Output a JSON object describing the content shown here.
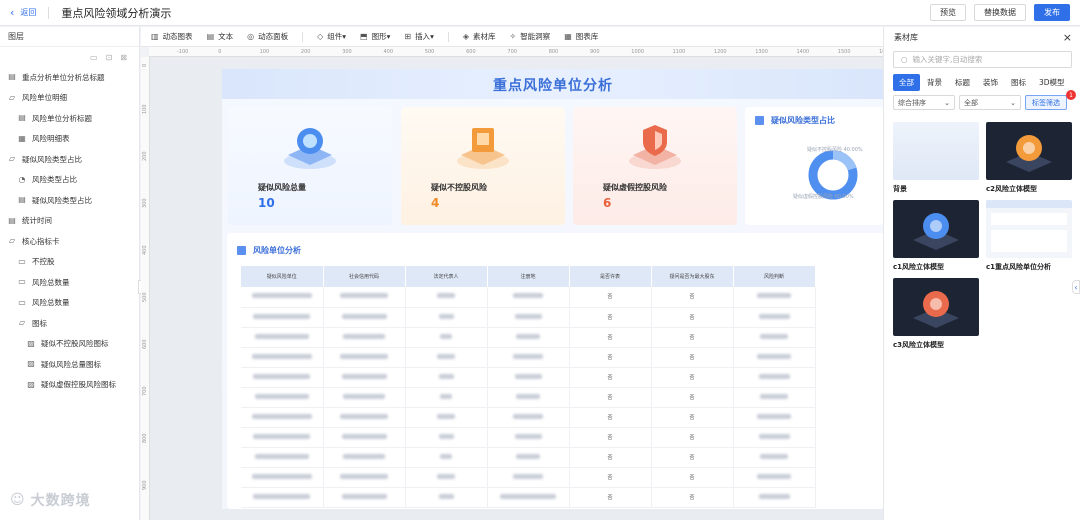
{
  "topbar": {
    "back_label": "返回",
    "title": "重点风险领域分析演示",
    "actions": [
      "预览",
      "替换数据",
      "发布"
    ]
  },
  "layers": {
    "title": "图层",
    "items": [
      {
        "label": "重点分析单位分析总标题",
        "level": 0,
        "icon": "text-icon"
      },
      {
        "label": "风险单位明细",
        "level": 0,
        "icon": "folder-icon"
      },
      {
        "label": "风险单位分析标题",
        "level": 1,
        "icon": "text-icon"
      },
      {
        "label": "风险明细表",
        "level": 1,
        "icon": "table-icon"
      },
      {
        "label": "疑似风险类型占比",
        "level": 0,
        "icon": "folder-icon"
      },
      {
        "label": "风险类型占比",
        "level": 1,
        "icon": "pie-icon"
      },
      {
        "label": "疑似风险类型占比",
        "level": 1,
        "icon": "text-icon"
      },
      {
        "label": "统计时间",
        "level": 0,
        "icon": "text-icon"
      },
      {
        "label": "核心指标卡",
        "level": 0,
        "icon": "folder-icon"
      },
      {
        "label": "不控股",
        "level": 1,
        "icon": "card-icon"
      },
      {
        "label": "风险总数量",
        "level": 1,
        "icon": "card-icon"
      },
      {
        "label": "风险总数量",
        "level": 1,
        "icon": "card-icon"
      },
      {
        "label": "图标",
        "level": 1,
        "icon": "folder-icon"
      },
      {
        "label": "疑似不控股风险图标",
        "level": 2,
        "icon": "image-icon"
      },
      {
        "label": "疑似风险总量图标",
        "level": 2,
        "icon": "image-icon"
      },
      {
        "label": "疑似虚假控股风险图标",
        "level": 2,
        "icon": "image-icon"
      }
    ]
  },
  "toolbar": {
    "items": [
      {
        "label": "动态图表",
        "icon": "chart-icon"
      },
      {
        "label": "文本",
        "icon": "text-icon"
      },
      {
        "label": "动态面板",
        "icon": "panel-icon"
      },
      {
        "label": "组件",
        "icon": "component-icon",
        "dropdown": true
      },
      {
        "label": "图形",
        "icon": "shape-icon",
        "dropdown": true
      },
      {
        "label": "插入",
        "icon": "insert-icon",
        "dropdown": true
      },
      {
        "label": "素材库",
        "icon": "material-icon"
      },
      {
        "label": "智能洞察",
        "icon": "insight-icon"
      },
      {
        "label": "图表库",
        "icon": "library-icon"
      }
    ]
  },
  "ruler": {
    "ticks": [
      "-100",
      "0",
      "100",
      "200",
      "300",
      "400",
      "500",
      "600",
      "700",
      "800",
      "900",
      "1000",
      "1100",
      "1200",
      "1300",
      "1400",
      "1500",
      "1600"
    ],
    "v_ticks": [
      "0",
      "100",
      "200",
      "300",
      "400",
      "500",
      "600",
      "700",
      "800",
      "900"
    ]
  },
  "dashboard": {
    "title": "重点风险单位分析",
    "cards": [
      {
        "label": "疑似风险总量",
        "value": "10",
        "color": "#2f6fe8"
      },
      {
        "label": "疑似不控股风险",
        "value": "4",
        "color": "#f08a24"
      },
      {
        "label": "疑似虚假控股风险",
        "value": "6",
        "color": "#e8603c"
      }
    ],
    "pie": {
      "title": "疑似风险类型占比",
      "legend_top": "疑似不控股风险 40.00%",
      "legend_bottom": "疑似虚假控股风险 60.00%"
    },
    "table": {
      "title": "风险单位分析",
      "headers": [
        "疑似风险单位",
        "社会信用代码",
        "法定代表人",
        "注册地",
        "是否许表",
        "疑问是否为最大股东",
        "风险判断"
      ],
      "second_col_values": [
        "否",
        "否",
        "否",
        "否",
        "否",
        "否",
        "否",
        "否",
        "否",
        "否",
        "否"
      ],
      "third_col_values": [
        "否",
        "否",
        "否",
        "否",
        "否",
        "否",
        "否",
        "否",
        "否",
        "否",
        "否"
      ],
      "row_count": 11,
      "visible_partial": "广东省深圳市...省"
    }
  },
  "materials": {
    "title": "素材库",
    "search_placeholder": "输入关键字,自动搜索",
    "categories": [
      "全部",
      "背景",
      "标题",
      "装饰",
      "图标",
      "3D模型"
    ],
    "active_category": "全部",
    "sort_label": "综合排序",
    "filter_label": "全部",
    "tag_button": "标签筛选",
    "badge": "1",
    "tiles": [
      {
        "name": "背景",
        "kind": "background"
      },
      {
        "name": "c2风险立体模型",
        "kind": "model-orange"
      },
      {
        "name": "c1风险立体模型",
        "kind": "model-blue"
      },
      {
        "name": "c1重点风险单位分析",
        "kind": "screenshot"
      },
      {
        "name": "c3风险立体模型",
        "kind": "model-red"
      }
    ]
  },
  "watermark": "大数跨境",
  "colors": {
    "accent": "#2f6fe8",
    "orange": "#f08a24",
    "red": "#e8603c"
  }
}
